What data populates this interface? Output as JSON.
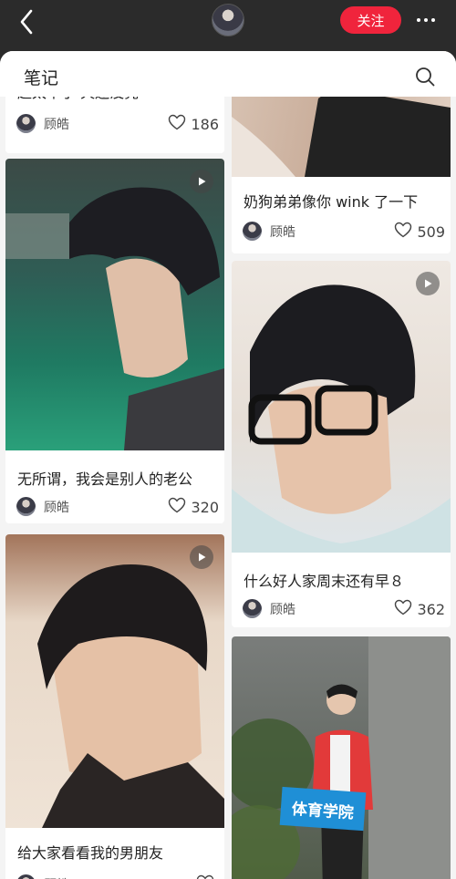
{
  "topbar": {
    "follow_label": "关注"
  },
  "header": {
    "title": "笔记"
  },
  "notes": [
    {
      "caption": "起太早了 天还没亮",
      "author": "顾皓",
      "likes": "186"
    },
    {
      "caption": "奶狗弟弟像你 wink 了一下",
      "author": "顾皓",
      "likes": "509"
    },
    {
      "caption": "无所谓，我会是别人的老公",
      "author": "顾皓",
      "likes": "320"
    },
    {
      "caption": "什么好人家周末还有早８",
      "author": "顾皓",
      "likes": "362"
    },
    {
      "caption": "给大家看看我的男朋友",
      "author": "顾皓",
      "likes": ""
    },
    {
      "caption": "",
      "author": "",
      "likes": "",
      "banner_text": "体育学院"
    }
  ]
}
